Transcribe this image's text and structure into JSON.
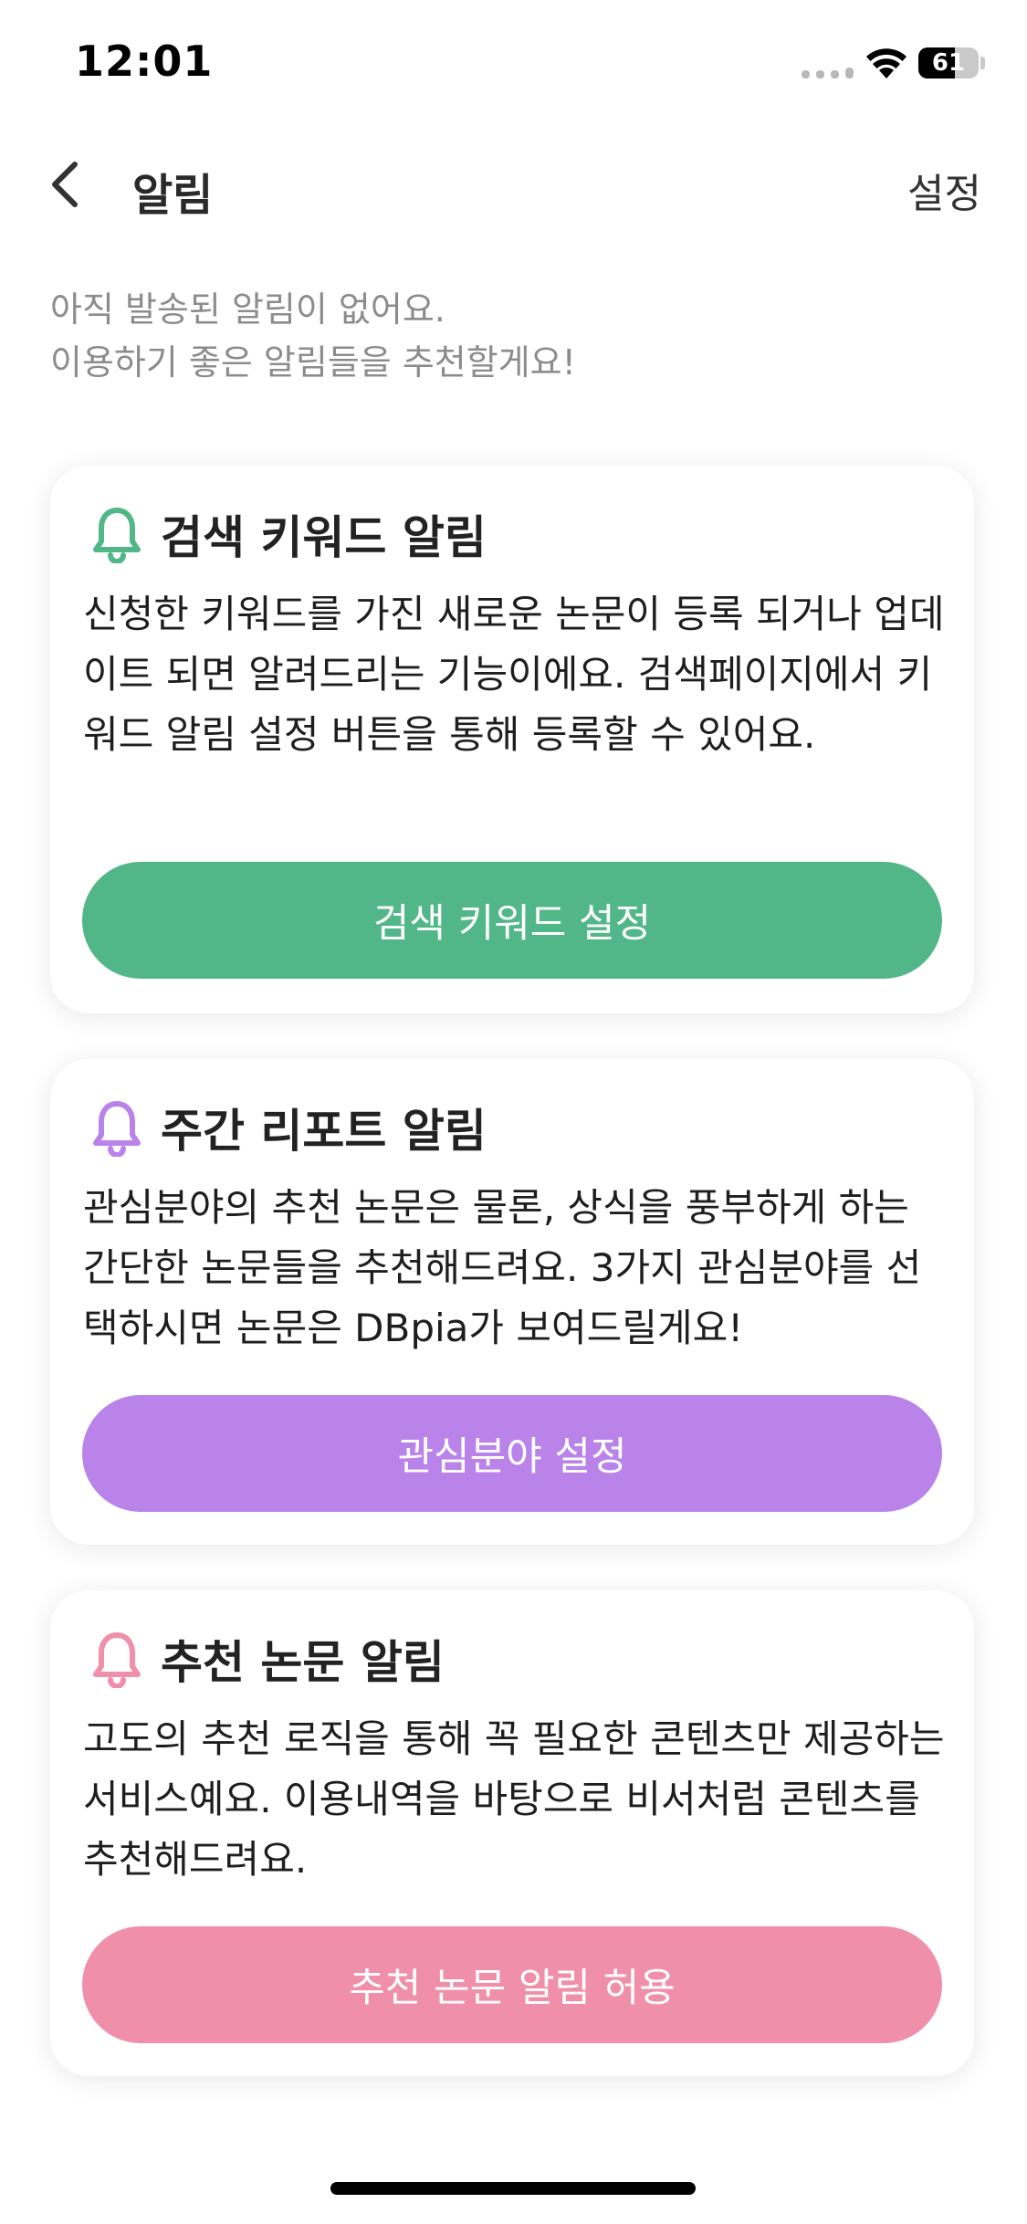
{
  "status_bar": {
    "time": "12:01",
    "battery_level": "61",
    "battery_fraction": 0.61
  },
  "header": {
    "title": "알림",
    "settings_label": "설정",
    "back_icon": "chevron-left-icon"
  },
  "intro": {
    "line1": "아직 발송된 알림이 없어요.",
    "line2": "이용하기 좋은 알림들을 추천할게요!"
  },
  "cards": [
    {
      "title": "검색 키워드 알림",
      "description": "신청한 키워드를 가진 새로운 논문이 등록 되거나 업데이트 되면 알려드리는 기능이에요. 검색페이지에서 키워드 알림 설정 버튼을 통해 등록할 수 있어요.",
      "button_label": "검색 키워드 설정",
      "icon": "bell-icon",
      "color": "#52b788"
    },
    {
      "title": "주간 리포트 알림",
      "description": "관심분야의 추천 논문은 물론, 상식을 풍부하게 하는 간단한 논문들을 추천해드려요. 3가지 관심분야를 선택하시면 논문은 DBpia가 보여드릴게요!",
      "button_label": "관심분야 설정",
      "icon": "bell-icon",
      "color": "#b983ea"
    },
    {
      "title": "추천 논문 알림",
      "description": "고도의 추천 로직을 통해 꼭 필요한 콘텐츠만 제공하는 서비스예요. 이용내역을 바탕으로 비서처럼 콘텐츠를 추천해드려요.",
      "button_label": "추천 논문 알림 허용",
      "icon": "bell-icon",
      "color": "#f08fa9"
    }
  ]
}
